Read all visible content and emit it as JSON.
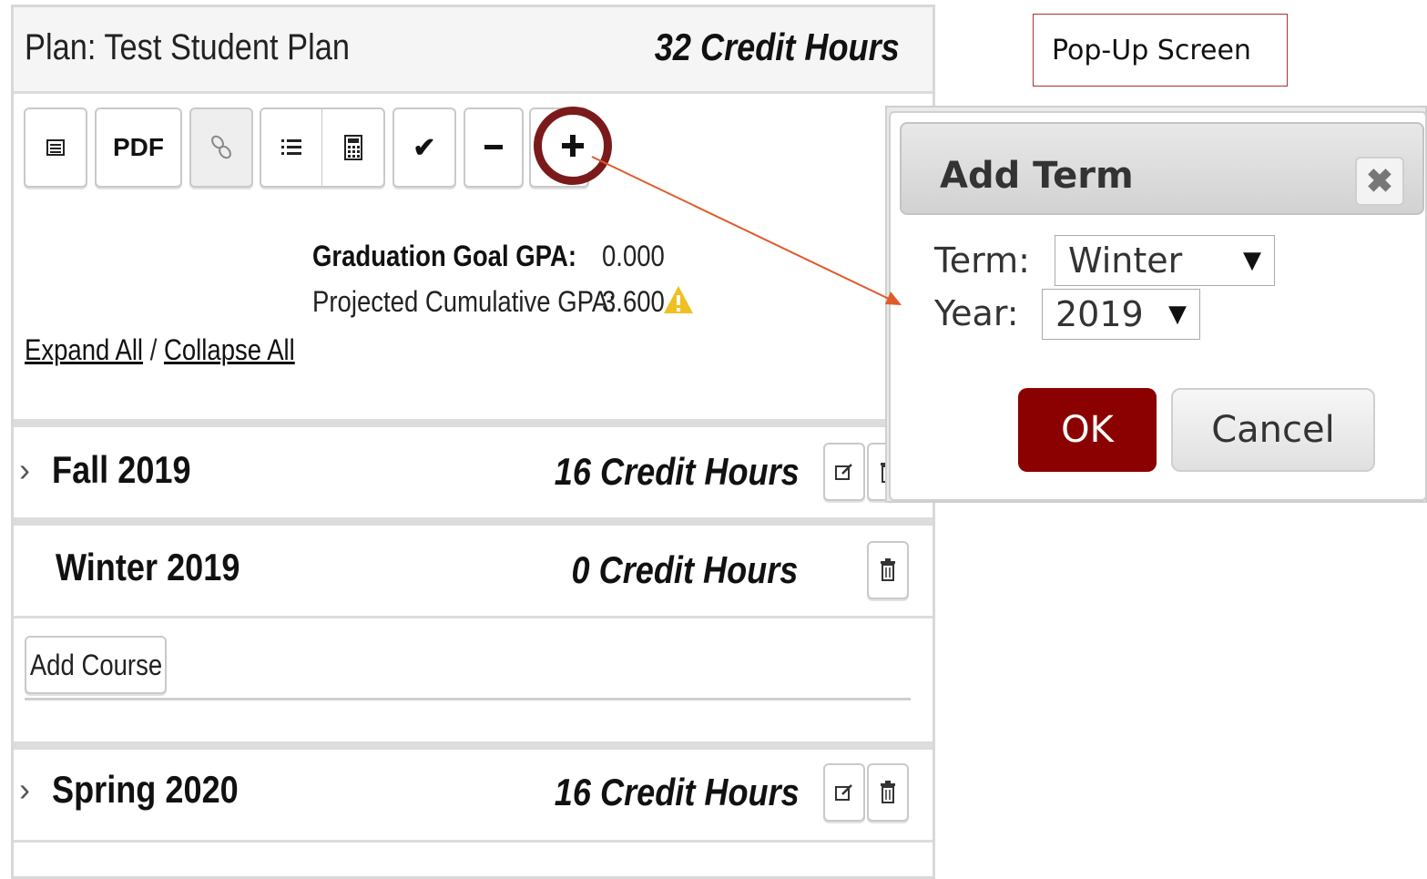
{
  "plan": {
    "title": "Plan: Test Student Plan",
    "total_credits": "32 Credit Hours"
  },
  "toolbar": {
    "pdf_label": "PDF",
    "icons": [
      "list-view-icon",
      "pdf-button",
      "link-icon",
      "list-icon",
      "calculator-icon",
      "check-icon",
      "minus-icon",
      "plus-icon"
    ]
  },
  "gpa": {
    "goal_label": "Graduation Goal GPA:",
    "goal_value": "0.000",
    "projected_label": "Projected Cumulative GPA:",
    "projected_value": "3.600"
  },
  "links": {
    "expand_all": "Expand All",
    "separator": " / ",
    "collapse_all": "Collapse All"
  },
  "terms": [
    {
      "name": "Fall 2019",
      "credits": "16 Credit Hours"
    },
    {
      "name": "Winter 2019",
      "credits": "0 Credit Hours"
    },
    {
      "name": "Spring 2020",
      "credits": "16 Credit Hours"
    }
  ],
  "add_course_label": "Add Course",
  "caption": "Pop-Up Screen",
  "dialog": {
    "title": "Add Term",
    "close_glyph": "✖",
    "term_label": "Term:",
    "term_value": "Winter",
    "year_label": "Year:",
    "year_value": "2019",
    "ok_label": "OK",
    "cancel_label": "Cancel"
  },
  "colors": {
    "accent_maroon": "#8b0000",
    "highlight_ring": "#7b1a1a",
    "arrow": "#e05a2b",
    "warning": "#f0c020"
  }
}
